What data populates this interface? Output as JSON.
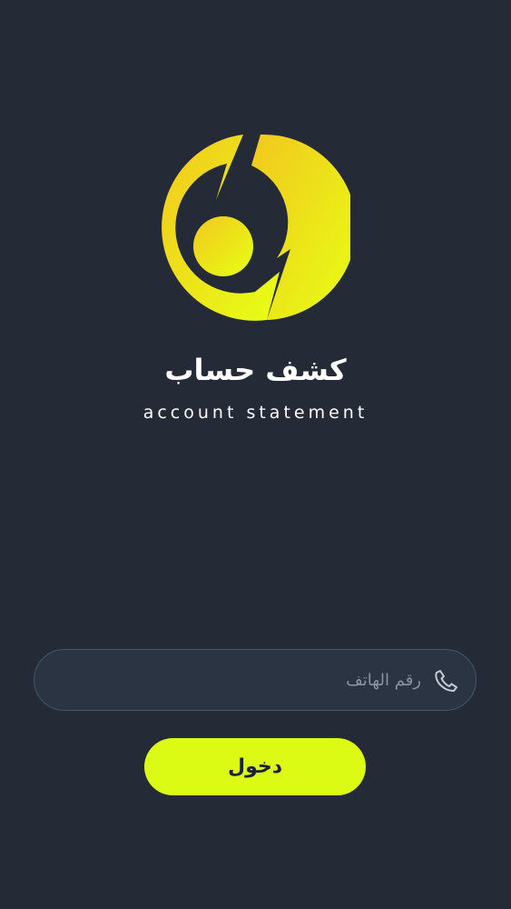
{
  "brand": {
    "title_ar": "كشف حساب",
    "title_en": "account statement",
    "logo_icon": "circular-gradient-logo-icon",
    "gradient_colors": [
      "#f2c81f",
      "#e7ff14"
    ]
  },
  "login": {
    "phone_placeholder": "رقم الهاتف",
    "phone_value": "",
    "phone_icon": "phone-icon",
    "submit_label": "دخول"
  },
  "colors": {
    "background": "#242b37",
    "input_border": "#4b5566",
    "button": "#dcfb14"
  }
}
